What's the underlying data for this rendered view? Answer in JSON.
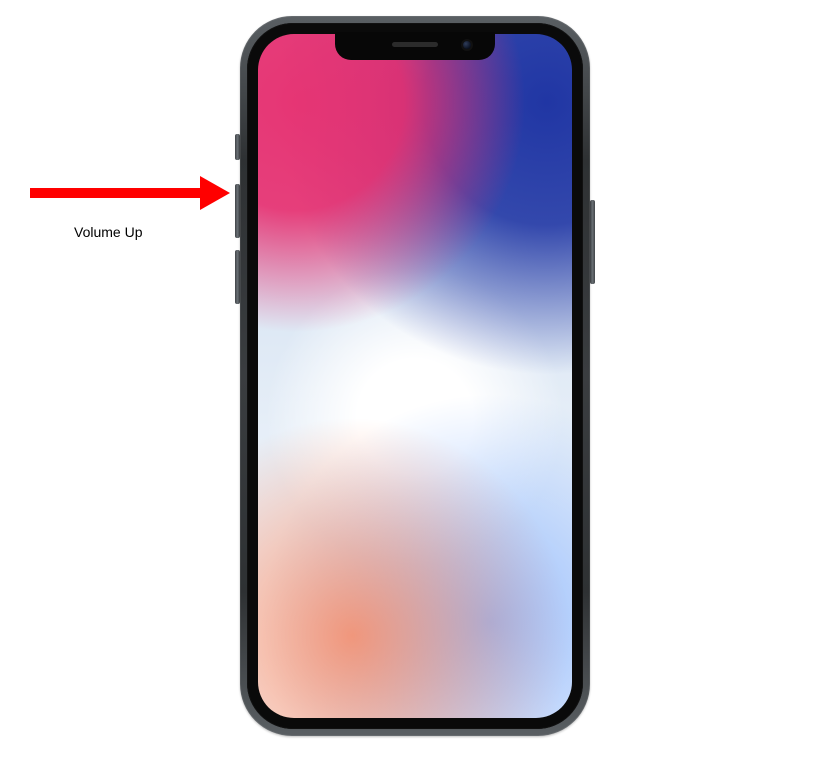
{
  "diagram": {
    "device": "iPhone X (front view)",
    "annotations": [
      {
        "label": "Volume Up",
        "target": "volume-up-button",
        "side": "left",
        "arrow_color": "#ff0000"
      }
    ],
    "buttons": {
      "mute_switch": {
        "side": "left"
      },
      "volume_up": {
        "side": "left"
      },
      "volume_down": {
        "side": "left"
      },
      "side_button": {
        "side": "right"
      }
    }
  }
}
